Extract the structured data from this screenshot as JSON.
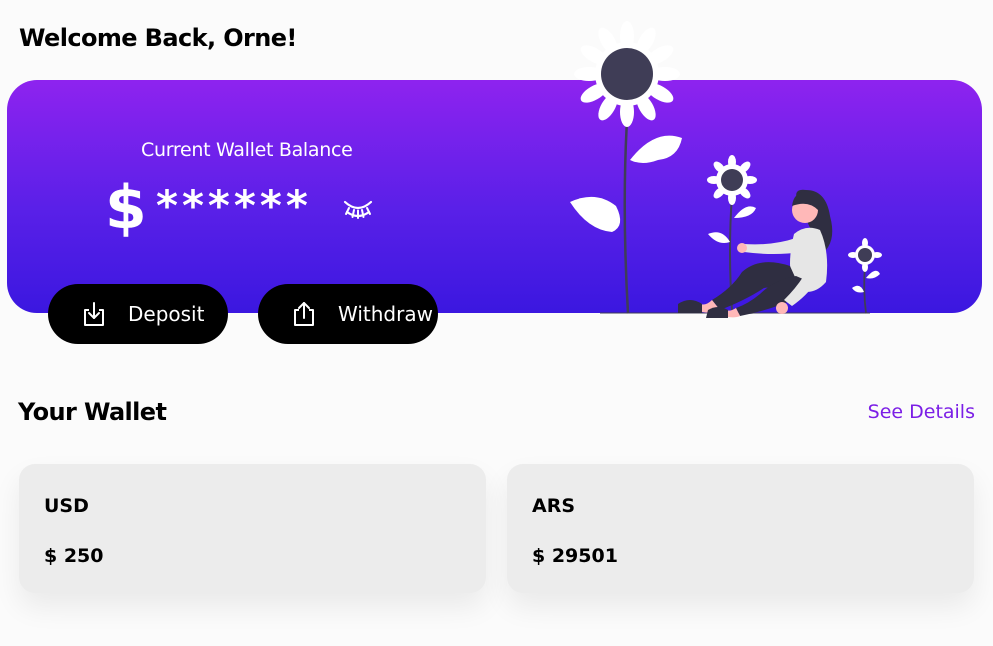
{
  "header": {
    "welcome": "Welcome Back, Orne!"
  },
  "balance_card": {
    "label": "Current Wallet Balance",
    "currency_symbol": "$",
    "masked_value": "******",
    "toggle_icon": "eye-closed-icon",
    "gradient_top": "#8e23ef",
    "gradient_bottom": "#3b17e0"
  },
  "actions": {
    "deposit_label": "Deposit",
    "deposit_icon": "download-icon",
    "withdraw_label": "Withdraw",
    "withdraw_icon": "upload-icon"
  },
  "wallet_section": {
    "title": "Your Wallet",
    "link_label": "See Details",
    "link_color": "#7b1ee6",
    "cards": [
      {
        "currency": "USD",
        "amount": "$ 250"
      },
      {
        "currency": "ARS",
        "amount": "$ 29501"
      }
    ]
  }
}
